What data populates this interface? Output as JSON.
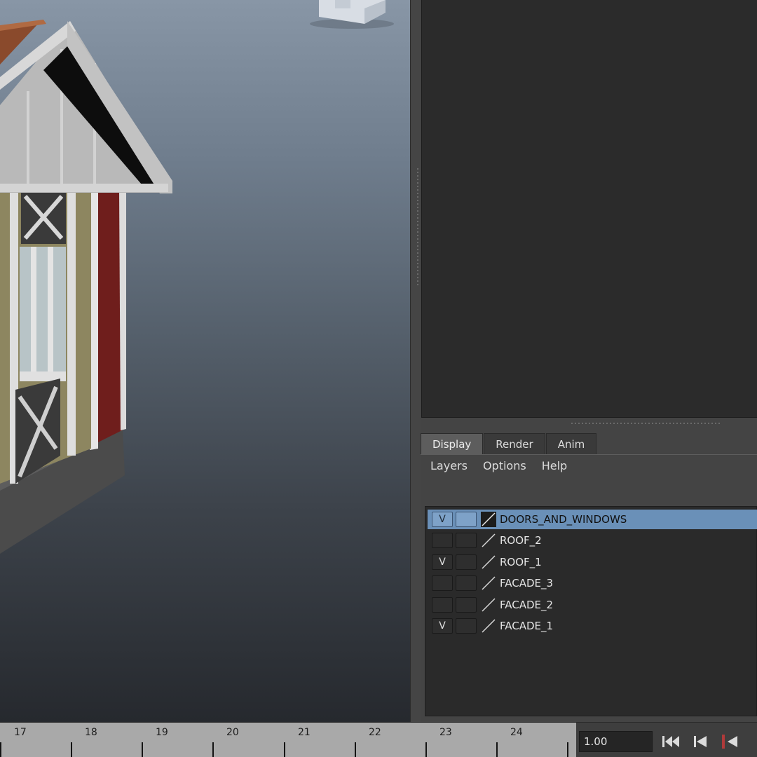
{
  "layer_editor": {
    "tabs": [
      {
        "label": "Display",
        "active": true
      },
      {
        "label": "Render",
        "active": false
      },
      {
        "label": "Anim",
        "active": false
      }
    ],
    "menu": [
      "Layers",
      "Options",
      "Help"
    ],
    "layers": [
      {
        "name": "DOORS_AND_WINDOWS",
        "visible": "V",
        "selected": true
      },
      {
        "name": "ROOF_2",
        "visible": "",
        "selected": false
      },
      {
        "name": "ROOF_1",
        "visible": "V",
        "selected": false
      },
      {
        "name": "FACADE_3",
        "visible": "",
        "selected": false
      },
      {
        "name": "FACADE_2",
        "visible": "",
        "selected": false
      },
      {
        "name": "FACADE_1",
        "visible": "V",
        "selected": false
      }
    ]
  },
  "timeline": {
    "frames": [
      "17",
      "18",
      "19",
      "20",
      "21",
      "22",
      "23",
      "24"
    ],
    "current_frame": "1.00"
  },
  "icons": {
    "viewcube": "viewcube-icon",
    "layer_type": "layer-type-icon",
    "go_to_start": "go-to-start-icon",
    "step_back_key": "step-back-key-icon",
    "step_back_frame": "step-back-frame-icon"
  },
  "colors": {
    "selected_row": "#6a90b8",
    "panel_bg": "#444444",
    "list_bg": "#2a2a2a"
  }
}
